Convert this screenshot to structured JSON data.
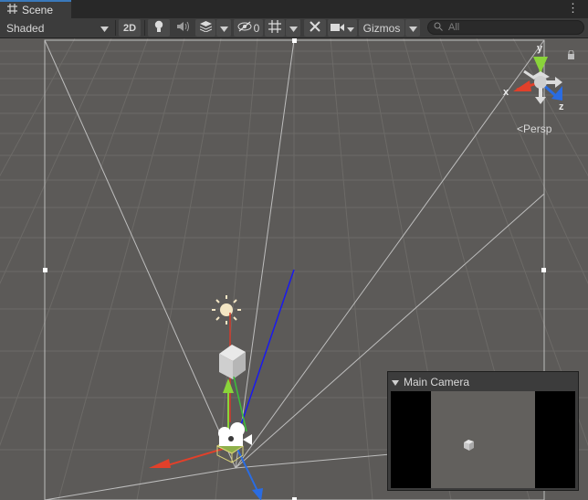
{
  "tab": {
    "label": "Scene"
  },
  "toolbar": {
    "draw_mode": "Shaded",
    "btn_2d": "2D",
    "hidden_count": "0",
    "gizmos_label": "Gizmos",
    "search_placeholder": "All"
  },
  "viewport": {
    "projection_label": "Persp",
    "axis_x": "x",
    "axis_y": "y",
    "axis_z": "z"
  },
  "camera_preview": {
    "title": "Main Camera"
  },
  "colors": {
    "axis_x": "#e2402a",
    "axis_y": "#8ad43a",
    "axis_z": "#2a6ce2",
    "tab_accent": "#3a79bb"
  }
}
